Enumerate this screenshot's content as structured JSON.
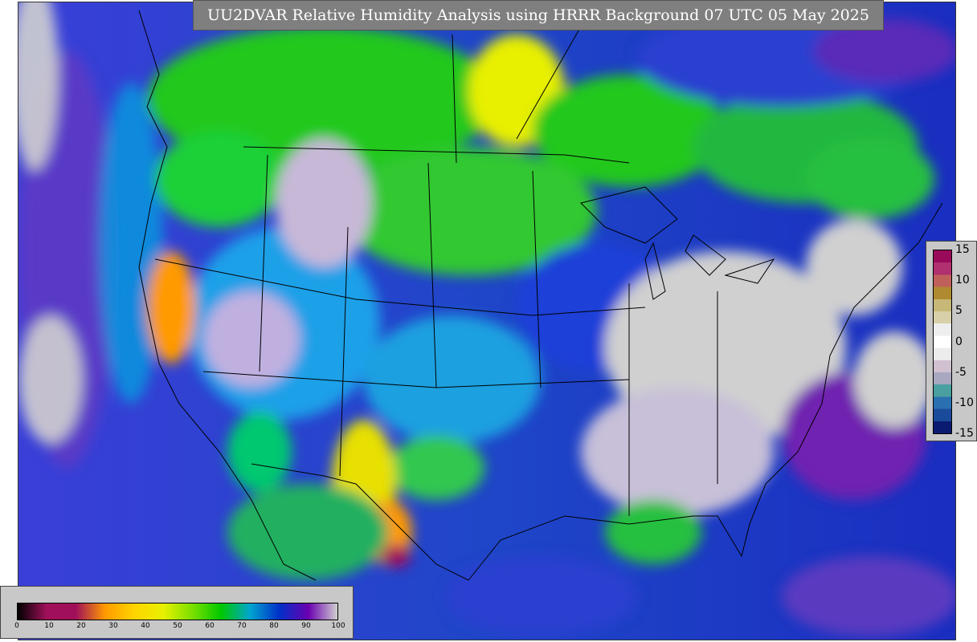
{
  "title": "UU2DVAR Relative Humidity Analysis using HRRR Background 07 UTC 05 May 2025",
  "rh_colorbar": {
    "ticks": [
      "0",
      "10",
      "20",
      "30",
      "40",
      "50",
      "60",
      "70",
      "80",
      "90",
      "100"
    ],
    "colors": [
      "#000000",
      "#a0105a",
      "#a0105a",
      "#ff9a00",
      "#ffd400",
      "#e8f000",
      "#7ce000",
      "#00c800",
      "#00a5d0",
      "#0030c8",
      "#6a00b0",
      "#d0d0d0"
    ]
  },
  "diff_colorbar": {
    "ticks": [
      "15",
      "10",
      "5",
      "0",
      "-5",
      "-10",
      "-15"
    ],
    "colors": [
      "#9a0a5a",
      "#b03070",
      "#c0605a",
      "#b08a30",
      "#c8b878",
      "#d8d0a8",
      "#eeeeee",
      "#ffffff",
      "#ececec",
      "#d0c0d0",
      "#a8a8c0",
      "#4aa0a0",
      "#2a70b0",
      "#1a4a9a",
      "#0a1a70"
    ]
  }
}
